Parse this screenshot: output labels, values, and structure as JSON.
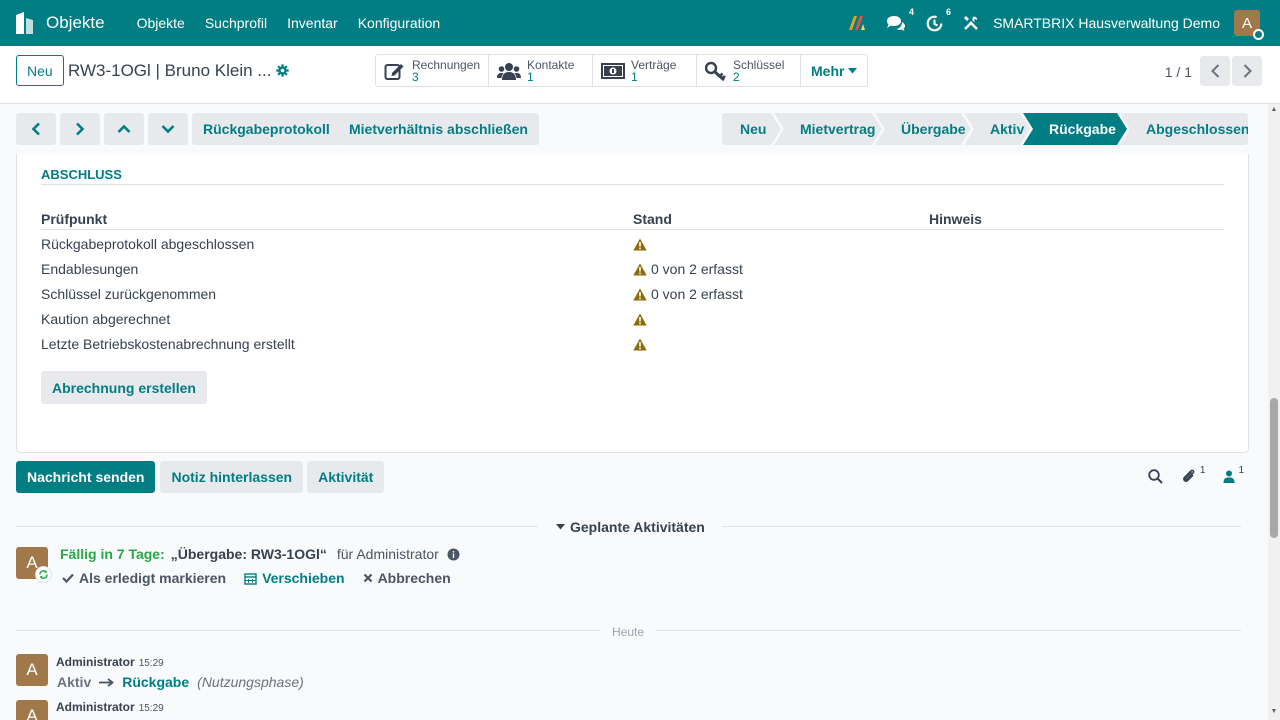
{
  "navbar": {
    "brand": "Objekte",
    "menu": [
      "Objekte",
      "Suchprofil",
      "Inventar",
      "Konfiguration"
    ],
    "messages_count": "4",
    "activities_count": "6",
    "company": "SMARTBRIX Hausverwaltung Demo",
    "avatar_letter": "A"
  },
  "control": {
    "new_label": "Neu",
    "record_title": "RW3-1OGl | Bruno Klein ...",
    "smart_buttons": [
      {
        "label": "Rechnungen",
        "count": "3",
        "icon": "pencil-square-icon"
      },
      {
        "label": "Kontakte",
        "count": "1",
        "icon": "users-icon"
      },
      {
        "label": "Verträge",
        "count": "1",
        "icon": "money-icon"
      },
      {
        "label": "Schlüssel",
        "count": "2",
        "icon": "key-icon"
      }
    ],
    "more_label": "Mehr",
    "pager": "1 / 1"
  },
  "statusbar": {
    "action_buttons": [
      "Rückgabeprotokoll",
      "Mietverhältnis abschließen"
    ],
    "stages": [
      "Neu",
      "Mietvertrag",
      "Übergabe",
      "Aktiv",
      "Rückgabe",
      "Abgeschlossen"
    ],
    "active_stage": "Rückgabe"
  },
  "section": {
    "title": "ABSCHLUSS",
    "headers": {
      "check": "Prüfpunkt",
      "state": "Stand",
      "note": "Hinweis"
    },
    "rows": [
      {
        "check": "Rückgabeprotokoll abgeschlossen",
        "state": ""
      },
      {
        "check": "Endablesungen",
        "state": "0 von 2 erfasst"
      },
      {
        "check": "Schlüssel zurückgenommen",
        "state": "0 von 2 erfasst"
      },
      {
        "check": "Kaution abgerechnet",
        "state": ""
      },
      {
        "check": "Letzte Betriebskostenabrechnung erstellt",
        "state": ""
      }
    ],
    "button": "Abrechnung erstellen"
  },
  "chatter": {
    "send_message": "Nachricht senden",
    "log_note": "Notiz hinterlassen",
    "activity": "Aktivität",
    "attachments_count": "1",
    "followers_count": "1",
    "planned_title": "Geplante Aktivitäten",
    "activity_item": {
      "avatar": "A",
      "due": "Fällig in 7 Tage:",
      "name": "„Übergabe: RW3-1OGl“",
      "for": "für Administrator",
      "mark_done": "Als erledigt markieren",
      "reschedule": "Verschieben",
      "cancel": "Abbrechen"
    },
    "today_label": "Heute",
    "messages": [
      {
        "avatar": "A",
        "author": "Administrator",
        "time": "15:29",
        "old": "Aktiv",
        "new": "Rückgabe",
        "field": "(Nutzungsphase)"
      },
      {
        "avatar": "A",
        "author": "Administrator",
        "time": "15:29"
      }
    ]
  },
  "colors": {
    "primary": "#017e84",
    "warning": "#8a6d0b",
    "due": "#28a745"
  }
}
